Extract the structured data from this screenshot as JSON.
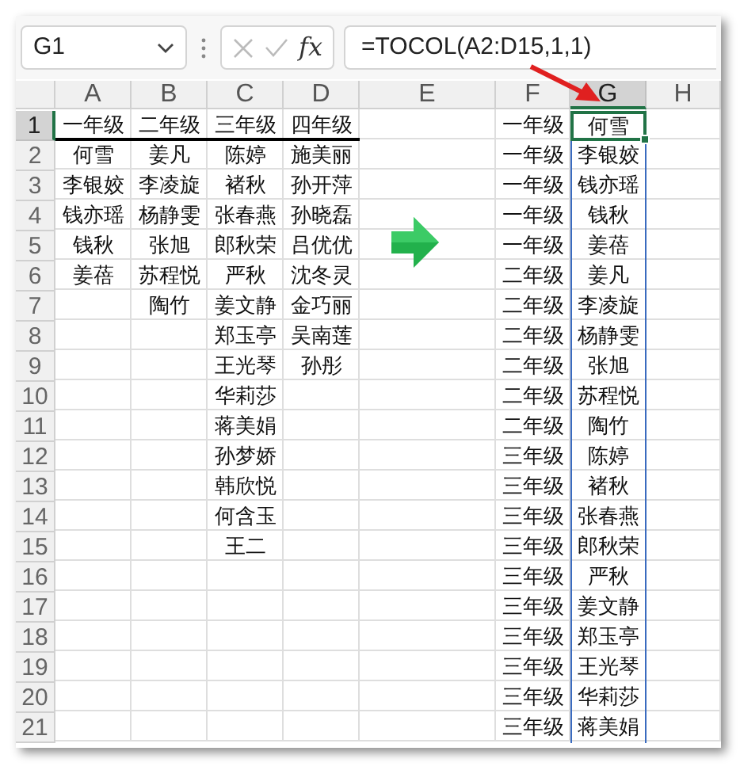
{
  "name_box": {
    "value": "G1"
  },
  "fx_label": "fx",
  "formula_bar": {
    "value": "=TOCOL(A2:D15,1,1)"
  },
  "columns": [
    {
      "label": "A",
      "selected": false
    },
    {
      "label": "B",
      "selected": false
    },
    {
      "label": "C",
      "selected": false
    },
    {
      "label": "D",
      "selected": false
    },
    {
      "label": "E",
      "selected": false
    },
    {
      "label": "F",
      "selected": false
    },
    {
      "label": "G",
      "selected": true
    },
    {
      "label": "H",
      "selected": false
    }
  ],
  "row_headers": [
    {
      "label": "1",
      "selected": true
    },
    {
      "label": "2",
      "selected": false
    },
    {
      "label": "3",
      "selected": false
    },
    {
      "label": "4",
      "selected": false
    },
    {
      "label": "5",
      "selected": false
    },
    {
      "label": "6",
      "selected": false
    },
    {
      "label": "7",
      "selected": false
    },
    {
      "label": "8",
      "selected": false
    },
    {
      "label": "9",
      "selected": false
    },
    {
      "label": "10",
      "selected": false
    },
    {
      "label": "11",
      "selected": false
    },
    {
      "label": "12",
      "selected": false
    },
    {
      "label": "13",
      "selected": false
    },
    {
      "label": "14",
      "selected": false
    },
    {
      "label": "15",
      "selected": false
    },
    {
      "label": "16",
      "selected": false
    },
    {
      "label": "17",
      "selected": false
    },
    {
      "label": "18",
      "selected": false
    },
    {
      "label": "19",
      "selected": false
    },
    {
      "label": "20",
      "selected": false
    },
    {
      "label": "21",
      "selected": false
    }
  ],
  "source": {
    "headers": [
      "一年级",
      "二年级",
      "三年级",
      "四年级"
    ],
    "columns": [
      [
        "何雪",
        "李银姣",
        "钱亦瑶",
        "钱秋",
        "姜蓓"
      ],
      [
        "姜凡",
        "李凌旋",
        "杨静雯",
        "张旭",
        "苏程悦",
        "陶竹"
      ],
      [
        "陈婷",
        "褚秋",
        "张春燕",
        "郎秋荣",
        "严秋",
        "姜文静",
        "郑玉亭",
        "王光琴",
        "华莉莎",
        "蒋美娟",
        "孙梦娇",
        "韩欣悦",
        "何含玉",
        "王二"
      ],
      [
        "施美丽",
        "孙开萍",
        "孙晓磊",
        "吕优优",
        "沈冬灵",
        "金巧丽",
        "吴南莲",
        "孙彤"
      ]
    ]
  },
  "result": [
    {
      "grade": "一年级",
      "name": "何雪",
      "selected": true
    },
    {
      "grade": "一年级",
      "name": "李银姣",
      "selected": false
    },
    {
      "grade": "一年级",
      "name": "钱亦瑶",
      "selected": false
    },
    {
      "grade": "一年级",
      "name": "钱秋",
      "selected": false
    },
    {
      "grade": "一年级",
      "name": "姜蓓",
      "selected": false
    },
    {
      "grade": "二年级",
      "name": "姜凡",
      "selected": false
    },
    {
      "grade": "二年级",
      "name": "李凌旋",
      "selected": false
    },
    {
      "grade": "二年级",
      "name": "杨静雯",
      "selected": false
    },
    {
      "grade": "二年级",
      "name": "张旭",
      "selected": false
    },
    {
      "grade": "二年级",
      "name": "苏程悦",
      "selected": false
    },
    {
      "grade": "二年级",
      "name": "陶竹",
      "selected": false
    },
    {
      "grade": "三年级",
      "name": "陈婷",
      "selected": false
    },
    {
      "grade": "三年级",
      "name": "褚秋",
      "selected": false
    },
    {
      "grade": "三年级",
      "name": "张春燕",
      "selected": false
    },
    {
      "grade": "三年级",
      "name": "郎秋荣",
      "selected": false
    },
    {
      "grade": "三年级",
      "name": "严秋",
      "selected": false
    },
    {
      "grade": "三年级",
      "name": "姜文静",
      "selected": false
    },
    {
      "grade": "三年级",
      "name": "郑玉亭",
      "selected": false
    },
    {
      "grade": "三年级",
      "name": "王光琴",
      "selected": false
    },
    {
      "grade": "三年级",
      "name": "华莉莎",
      "selected": false
    },
    {
      "grade": "三年级",
      "name": "蒋美娟",
      "selected": false
    }
  ]
}
